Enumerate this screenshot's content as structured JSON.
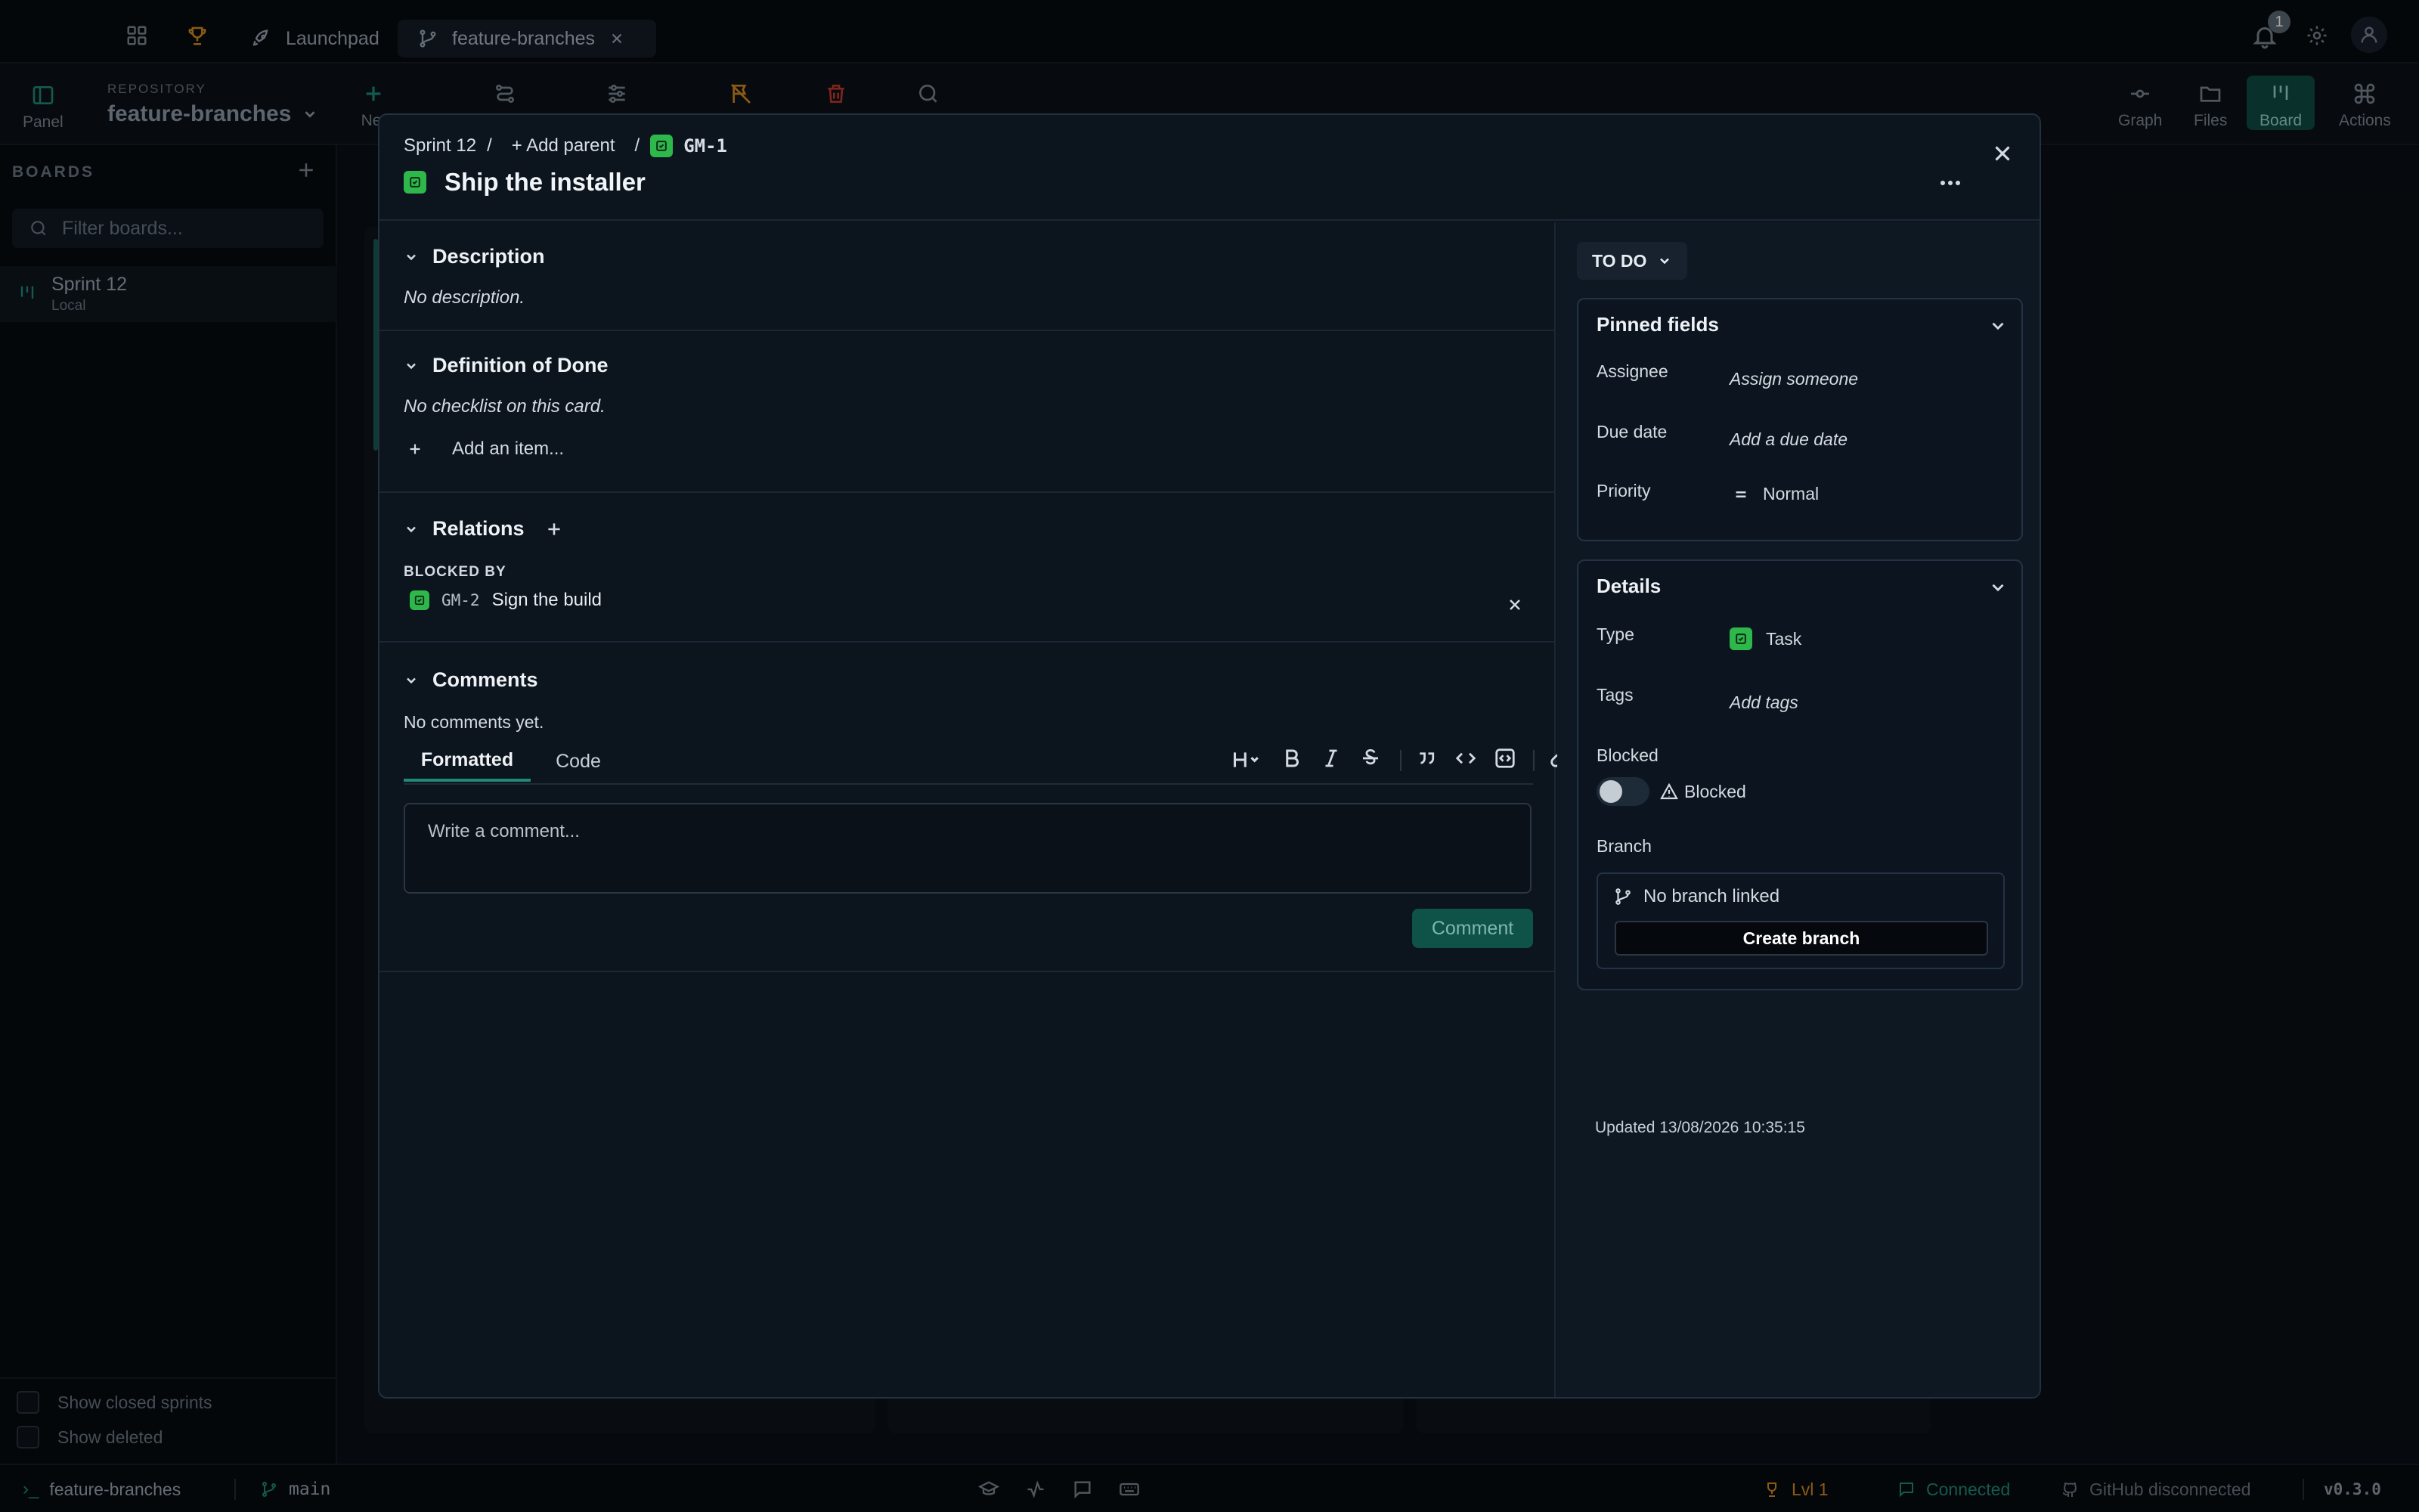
{
  "tabs": {
    "launchpad": "Launchpad",
    "repo_tab": "feature-branches"
  },
  "notifications": {
    "count": "1"
  },
  "toolbar": {
    "panel": "Panel",
    "repo_label": "REPOSITORY",
    "repo_name": "feature-branches",
    "new_partial": "Ne",
    "graph": "Graph",
    "files": "Files",
    "board": "Board",
    "actions": "Actions"
  },
  "sidebar": {
    "title": "BOARDS",
    "filter_placeholder": "Filter boards...",
    "items": [
      {
        "name": "Sprint 12",
        "sub": "Local"
      }
    ],
    "show_closed": "Show closed sprints",
    "show_deleted": "Show deleted"
  },
  "modal": {
    "breadcrumb": {
      "sprint": "Sprint 12",
      "sep": "/",
      "add_parent": "+ Add parent",
      "key": "GM-1"
    },
    "title": "Ship the installer",
    "description": {
      "heading": "Description",
      "empty": "No description."
    },
    "dod": {
      "heading": "Definition of Done",
      "empty": "No checklist on this card.",
      "add_item": "Add an item..."
    },
    "relations": {
      "heading": "Relations",
      "group": "BLOCKED BY",
      "items": [
        {
          "key": "GM-2",
          "title": "Sign the build"
        }
      ]
    },
    "comments": {
      "heading": "Comments",
      "empty": "No comments yet.",
      "tab_formatted": "Formatted",
      "tab_code": "Code",
      "placeholder": "Write a comment...",
      "submit": "Comment"
    },
    "side": {
      "status": "TO DO",
      "pinned": {
        "title": "Pinned fields",
        "assignee_label": "Assignee",
        "assignee_value": "Assign someone",
        "due_label": "Due date",
        "due_value": "Add a due date",
        "priority_label": "Priority",
        "priority_value": "Normal"
      },
      "details": {
        "title": "Details",
        "type_label": "Type",
        "type_value": "Task",
        "tags_label": "Tags",
        "tags_value": "Add tags",
        "blocked_label": "Blocked",
        "blocked_value": "Blocked",
        "branch_label": "Branch",
        "branch_value": "No branch linked",
        "create_branch": "Create branch"
      },
      "updated": "Updated 13/08/2026 10:35:15"
    }
  },
  "statusbar": {
    "repo": "feature-branches",
    "branch": "main",
    "level": "Lvl 1",
    "connection": "Connected",
    "github": "GitHub disconnected",
    "version": "v0.3.0"
  },
  "colors": {
    "accent": "#1f8a78",
    "task_green": "#2eb84b",
    "danger": "#c0392b",
    "warning": "#d98a1e"
  }
}
